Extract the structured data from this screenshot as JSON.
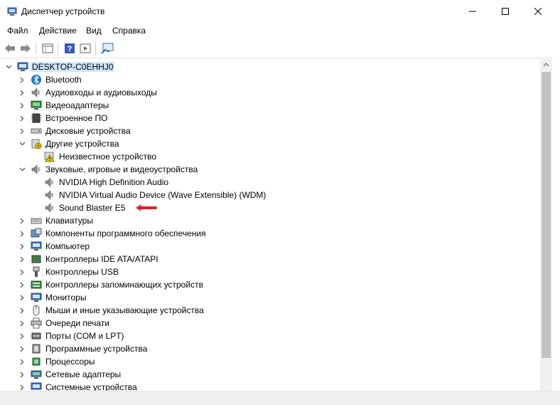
{
  "window": {
    "title": "Диспетчер устройств",
    "min_symbol": "—",
    "max_symbol": "☐",
    "close_symbol": "✕"
  },
  "menu": [
    "Файл",
    "Действие",
    "Вид",
    "Справка"
  ],
  "toolbar_icons": [
    "back-arrow-icon",
    "forward-arrow-icon",
    "properties-grid-icon",
    "help-icon",
    "run-icon",
    "monitor-scan-icon"
  ],
  "tree": {
    "root": "DESKTOP-C0EHHJ0",
    "categories": [
      {
        "label": "Bluetooth",
        "icon": "bluetooth-icon",
        "expanded": false
      },
      {
        "label": "Аудиовходы и аудиовыходы",
        "icon": "speaker-icon",
        "expanded": false
      },
      {
        "label": "Видеоадаптеры",
        "icon": "display-adapter-icon",
        "expanded": false
      },
      {
        "label": "Встроенное ПО",
        "icon": "firmware-icon",
        "expanded": false
      },
      {
        "label": "Дисковые устройства",
        "icon": "disk-drive-icon",
        "expanded": false
      },
      {
        "label": "Другие устройства",
        "icon": "unknown-device-icon",
        "expanded": true,
        "children": [
          {
            "label": "Неизвестное устройство",
            "icon": "warning-device-icon"
          }
        ]
      },
      {
        "label": "Звуковые, игровые и видеоустройства",
        "icon": "speaker-icon",
        "expanded": true,
        "children": [
          {
            "label": "NVIDIA High Definition Audio",
            "icon": "speaker-icon"
          },
          {
            "label": "NVIDIA Virtual Audio Device (Wave Extensible) (WDM)",
            "icon": "speaker-icon"
          },
          {
            "label": "Sound Blaster E5",
            "icon": "speaker-icon",
            "annotation": "red-arrow-icon"
          }
        ]
      },
      {
        "label": "Клавиатуры",
        "icon": "keyboard-icon",
        "expanded": false
      },
      {
        "label": "Компоненты программного обеспечения",
        "icon": "software-component-icon",
        "expanded": false
      },
      {
        "label": "Компьютер",
        "icon": "computer-icon",
        "expanded": false
      },
      {
        "label": "Контроллеры IDE ATA/ATAPI",
        "icon": "ide-controller-icon",
        "expanded": false
      },
      {
        "label": "Контроллеры USB",
        "icon": "usb-icon",
        "expanded": false
      },
      {
        "label": "Контроллеры запоминающих устройств",
        "icon": "storage-controller-icon",
        "expanded": false
      },
      {
        "label": "Мониторы",
        "icon": "monitor-icon",
        "expanded": false
      },
      {
        "label": "Мыши и иные указывающие устройства",
        "icon": "mouse-icon",
        "expanded": false
      },
      {
        "label": "Очереди печати",
        "icon": "printer-icon",
        "expanded": false
      },
      {
        "label": "Порты (COM и LPT)",
        "icon": "port-icon",
        "expanded": false
      },
      {
        "label": "Программные устройства",
        "icon": "software-device-icon",
        "expanded": false
      },
      {
        "label": "Процессоры",
        "icon": "processor-icon",
        "expanded": false
      },
      {
        "label": "Сетевые адаптеры",
        "icon": "network-adapter-icon",
        "expanded": false
      },
      {
        "label": "Системные устройства",
        "icon": "system-device-icon",
        "expanded": false
      }
    ]
  },
  "colors": {
    "selection": "#cce8ff",
    "annotation": "#e02020"
  }
}
